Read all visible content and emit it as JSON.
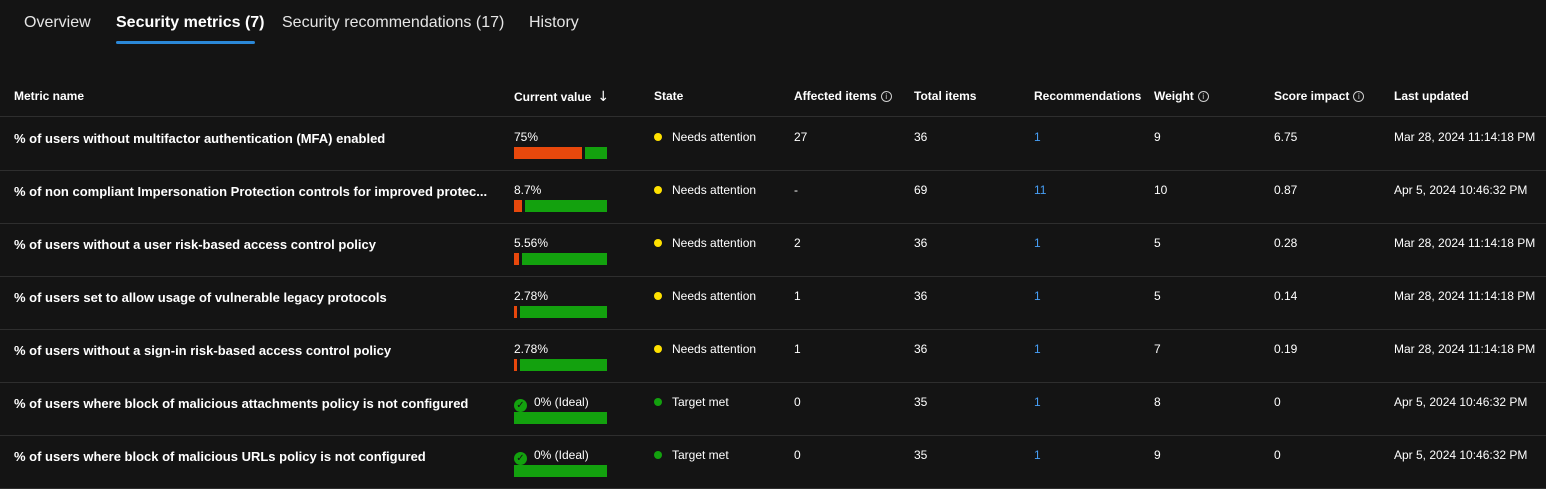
{
  "tabs": [
    {
      "label": "Overview"
    },
    {
      "label": "Security metrics (7)"
    },
    {
      "label": "Security recommendations (17)"
    },
    {
      "label": "History"
    }
  ],
  "columns": {
    "metric_name": "Metric name",
    "current_value": "Current value",
    "state": "State",
    "affected_items": "Affected items",
    "total_items": "Total items",
    "recommendations": "Recommendations",
    "weight": "Weight",
    "score_impact": "Score impact",
    "last_updated": "Last updated"
  },
  "colors": {
    "attention": "#ffe100",
    "target_met": "#13a10e",
    "bar_bad": "#e8480c",
    "bar_good": "#13a10e",
    "link": "#479ef5",
    "tab_accent": "#2b88d8"
  },
  "rows": [
    {
      "metric": "% of users without multifactor authentication (MFA) enabled",
      "current_value": "75%",
      "bad_fraction": 0.75,
      "ideal": false,
      "state": "Needs attention",
      "affected": "27",
      "total": "36",
      "recommendations": "1",
      "weight": "9",
      "score_impact": "6.75",
      "last_updated": "Mar 28, 2024 11:14:18 PM"
    },
    {
      "metric": "% of non compliant Impersonation Protection controls for improved protec...",
      "current_value": "8.7%",
      "bad_fraction": 0.087,
      "ideal": false,
      "state": "Needs attention",
      "affected": "-",
      "total": "69",
      "recommendations": "11",
      "weight": "10",
      "score_impact": "0.87",
      "last_updated": "Apr 5, 2024 10:46:32 PM"
    },
    {
      "metric": "% of users without a user risk-based access control policy",
      "current_value": "5.56%",
      "bad_fraction": 0.0556,
      "ideal": false,
      "state": "Needs attention",
      "affected": "2",
      "total": "36",
      "recommendations": "1",
      "weight": "5",
      "score_impact": "0.28",
      "last_updated": "Mar 28, 2024 11:14:18 PM"
    },
    {
      "metric": "% of users set to allow usage of vulnerable legacy protocols",
      "current_value": "2.78%",
      "bad_fraction": 0.0278,
      "ideal": false,
      "state": "Needs attention",
      "affected": "1",
      "total": "36",
      "recommendations": "1",
      "weight": "5",
      "score_impact": "0.14",
      "last_updated": "Mar 28, 2024 11:14:18 PM"
    },
    {
      "metric": "% of users without a sign-in risk-based access control policy",
      "current_value": "2.78%",
      "bad_fraction": 0.0278,
      "ideal": false,
      "state": "Needs attention",
      "affected": "1",
      "total": "36",
      "recommendations": "1",
      "weight": "7",
      "score_impact": "0.19",
      "last_updated": "Mar 28, 2024 11:14:18 PM"
    },
    {
      "metric": "% of users where block of malicious attachments policy is not configured",
      "current_value": "0% (Ideal)",
      "bad_fraction": 0,
      "ideal": true,
      "state": "Target met",
      "affected": "0",
      "total": "35",
      "recommendations": "1",
      "weight": "8",
      "score_impact": "0",
      "last_updated": "Apr 5, 2024 10:46:32 PM"
    },
    {
      "metric": "% of users where block of malicious URLs policy is not configured",
      "current_value": "0% (Ideal)",
      "bad_fraction": 0,
      "ideal": true,
      "state": "Target met",
      "affected": "0",
      "total": "35",
      "recommendations": "1",
      "weight": "9",
      "score_impact": "0",
      "last_updated": "Apr 5, 2024 10:46:32 PM"
    }
  ]
}
